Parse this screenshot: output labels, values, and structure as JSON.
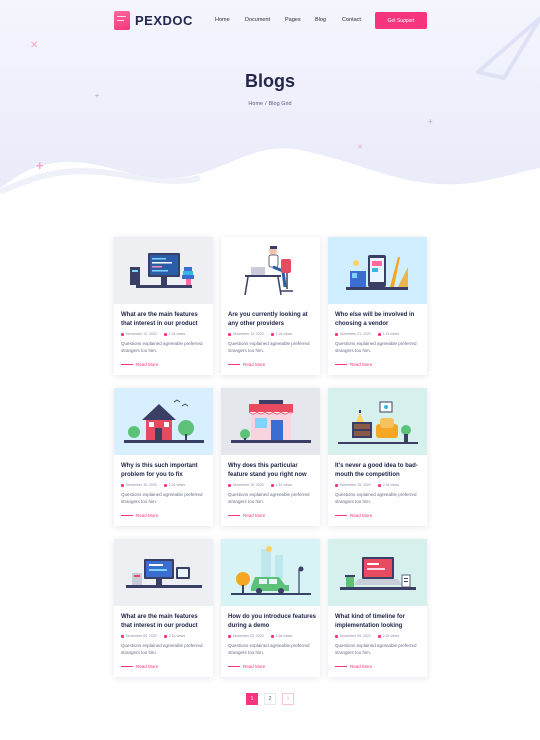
{
  "brand": {
    "name": "PEXDOC"
  },
  "nav": {
    "items": [
      "Home",
      "Document",
      "Pages",
      "Blog",
      "Contact"
    ],
    "cta": "Get Support"
  },
  "hero": {
    "title": "Blogs",
    "breadcrumb": {
      "home": "Home",
      "separator": "/",
      "current": "Blog Grid"
    }
  },
  "posts": [
    {
      "title": "What are the main features that interest in our product",
      "date": "November 12, 2020",
      "views": "1.2k views",
      "excerpt": "Questions explained agreeable preferred strangers too him.",
      "read_more": "Read More",
      "image": "coding-desk-illustration"
    },
    {
      "title": "Are you currently looking at any other providers",
      "date": "November 13, 2020",
      "views": "1.2k views",
      "excerpt": "Questions explained agreeable preferred strangers too him.",
      "read_more": "Read More",
      "image": "man-at-desk-illustration"
    },
    {
      "title": "Who else will be involved in choosing a vendor",
      "date": "November 21, 2020",
      "views": "1.1k views",
      "excerpt": "Questions explained agreeable preferred strangers too him.",
      "read_more": "Read More",
      "image": "design-tools-illustration"
    },
    {
      "title": "Why is this such important problem for you to fix",
      "date": "November 15, 2020",
      "views": "2.2k views",
      "excerpt": "Questions explained agreeable preferred strangers too him.",
      "read_more": "Read More",
      "image": "house-illustration"
    },
    {
      "title": "Why does this particular feature stand you right now",
      "date": "November 15, 2020",
      "views": "1.1k views",
      "excerpt": "Questions explained agreeable preferred strangers too him.",
      "read_more": "Read More",
      "image": "shop-illustration"
    },
    {
      "title": "It's never a good idea to bad-mouth the competition",
      "date": "November 15, 2020",
      "views": "2.2k views",
      "excerpt": "Questions explained agreeable preferred strangers too him.",
      "read_more": "Read More",
      "image": "living-room-illustration"
    },
    {
      "title": "What are the main features that interest in our product",
      "date": "November 09, 2020",
      "views": "2.1k views",
      "excerpt": "Questions explained agreeable preferred strangers too him.",
      "read_more": "Read More",
      "image": "office-computers-illustration"
    },
    {
      "title": "How do you introduce features during a demo",
      "date": "November 03, 2020",
      "views": "1.6k views",
      "excerpt": "Questions explained agreeable preferred strangers too him.",
      "read_more": "Read More",
      "image": "car-park-illustration"
    },
    {
      "title": "What kind of timeline for implementation looking",
      "date": "November 09, 2020",
      "views": "2.2k views",
      "excerpt": "Questions explained agreeable preferred strangers too him.",
      "read_more": "Read More",
      "image": "laptop-desk-illustration"
    }
  ],
  "pagination": {
    "pages": [
      "1",
      "2"
    ],
    "current": "1",
    "next": "›"
  },
  "colors": {
    "accent": "#f6357e",
    "heading": "#23264a",
    "hero_bg": "#eef0fb"
  }
}
